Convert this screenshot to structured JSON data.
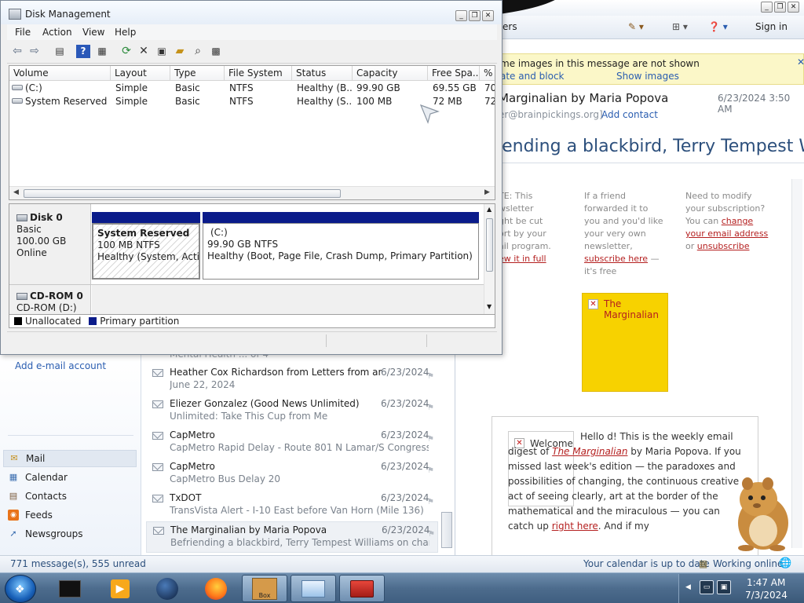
{
  "mail": {
    "toolbar": {
      "item_partial": "ers",
      "signin": "Sign in"
    },
    "left_pane": {
      "add_account": "Add e-mail account",
      "nav": [
        {
          "label": "Mail",
          "icon": "mail-icon"
        },
        {
          "label": "Calendar",
          "icon": "calendar-icon"
        },
        {
          "label": "Contacts",
          "icon": "contacts-icon"
        },
        {
          "label": "Feeds",
          "icon": "rss-feed-icon"
        },
        {
          "label": "Newsgroups",
          "icon": "newsgroups-icon"
        }
      ]
    },
    "messages": [
      {
        "from": "Heather Cox Richardson from Letters from an A...",
        "date": "6/23/2024",
        "subject": "June 22, 2024"
      },
      {
        "from": "Eliezer Gonzalez (Good News Unlimited)",
        "date": "6/23/2024",
        "subject": "Unlimited: Take This Cup from Me"
      },
      {
        "from": "CapMetro",
        "date": "6/23/2024",
        "subject": "CapMetro Rapid Delay - Route 801 N Lamar/S Congress"
      },
      {
        "from": "CapMetro",
        "date": "6/23/2024",
        "subject": "CapMetro Bus Delay 20"
      },
      {
        "from": "TxDOT",
        "date": "6/23/2024",
        "subject": "TransVista Alert - I-10 East before Van Horn (Mile 136)"
      },
      {
        "from": "The Marginalian by Maria Popova",
        "date": "6/23/2024",
        "subject": "Befriending a blackbird, Terry Tempest Williams on change..."
      }
    ],
    "partial_top_subject": "Mental Health ... of 4",
    "reading": {
      "infobar_line1": "me images in this message are not shown",
      "infobar_action1": "ate and block",
      "infobar_action2": "Show images",
      "from": "Marginalian by Maria Popova",
      "date": "6/23/2024 3:50 AM",
      "address": "er@brainpickings.org]",
      "add_contact": "Add contact",
      "subject": "iending a blackbird, Terry Tempest Wi",
      "col1_lines": [
        "TE: This",
        "wsletter",
        "ght be cut",
        "ort by your",
        "ail program."
      ],
      "col1_link": "ew it in full",
      "col2_lines": [
        "If a friend",
        "forwarded it to",
        "you and you'd like",
        "your very own",
        "newsletter,"
      ],
      "col2_link": "subscribe here",
      "col2_tail": "—",
      "col2_last": "it's free",
      "col3_lines": [
        "Need to modify",
        "your subscription?",
        "You can"
      ],
      "col3_link1": "change",
      "col3_link2": "your email address",
      "col3_or": "or",
      "col3_link3": "unsubscribe",
      "image_alt": "The Marginalian",
      "welcome_alt": "Welcome",
      "welcome_p1": "Hello d! This is the weekly email digest of",
      "welcome_em": "The Marginalian",
      "welcome_p2": "by Maria Popova. If you missed last week's edition — the paradoxes and possibilities of changing, the continuous creative act of seeing clearly, art at the border of the mathematical and the miraculous — you can catch up",
      "welcome_link": "right here",
      "welcome_p3": ". And if my"
    },
    "status": {
      "counts": "771 message(s), 555 unread",
      "calendar": "Your calendar is up to date",
      "online": "Working online"
    }
  },
  "disk_mgmt": {
    "title": "Disk Management",
    "menu": [
      "File",
      "Action",
      "View",
      "Help"
    ],
    "columns": [
      "Volume",
      "Layout",
      "Type",
      "File System",
      "Status",
      "Capacity",
      "Free Spa...",
      "%"
    ],
    "volumes": [
      {
        "volume": "(C:)",
        "layout": "Simple",
        "type": "Basic",
        "fs": "NTFS",
        "status": "Healthy (B...",
        "capacity": "99.90 GB",
        "free": "69.55 GB",
        "pct": "70"
      },
      {
        "volume": "System Reserved",
        "layout": "Simple",
        "type": "Basic",
        "fs": "NTFS",
        "status": "Healthy (S...",
        "capacity": "100 MB",
        "free": "72 MB",
        "pct": "72"
      }
    ],
    "disk0": {
      "name": "Disk 0",
      "type": "Basic",
      "size": "100.00 GB",
      "state": "Online",
      "partitions": [
        {
          "name": "System Reserved",
          "size": "100 MB NTFS",
          "status": "Healthy (System, Active"
        },
        {
          "name": "(C:)",
          "size": "99.90 GB NTFS",
          "status": "Healthy (Boot, Page File, Crash Dump, Primary Partition)"
        }
      ]
    },
    "cdrom0": {
      "name": "CD-ROM 0",
      "drive": "CD-ROM (D:)"
    },
    "legend": [
      {
        "label": "Unallocated",
        "color": "#000000"
      },
      {
        "label": "Primary partition",
        "color": "#0a1b8a"
      }
    ]
  },
  "taskbar": {
    "box_label": "Box",
    "clock_time": "1:47 AM",
    "clock_date": "7/3/2024"
  }
}
